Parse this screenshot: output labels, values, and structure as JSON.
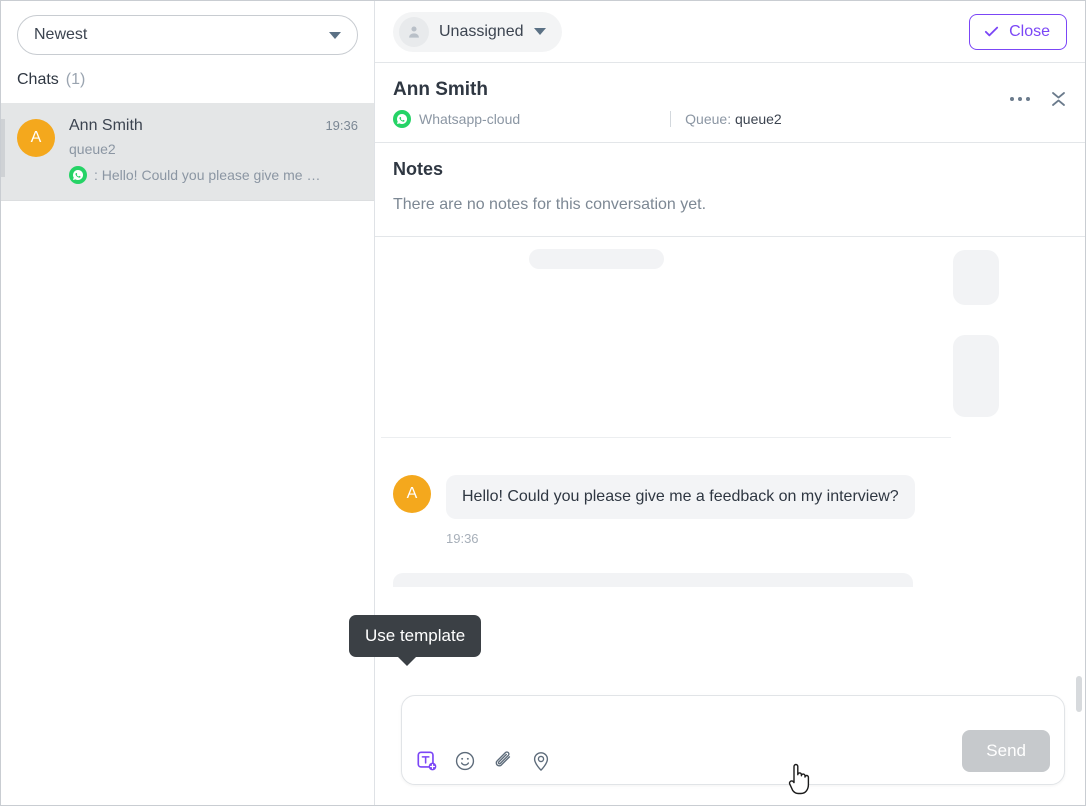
{
  "sidebar": {
    "sort": {
      "value": "Newest",
      "caret_icon": "chevron-down-icon"
    },
    "chats_header": {
      "label": "Chats",
      "count": "(1)"
    },
    "chats": [
      {
        "avatar_initial": "A",
        "name": "Ann Smith",
        "time": "19:36",
        "queue": "queue2",
        "channel_icon": "whatsapp-icon",
        "preview": ": Hello! Could you please give me …"
      }
    ]
  },
  "topbar": {
    "assignee": {
      "label": "Unassigned",
      "avatar_icon": "person-icon",
      "caret_icon": "chevron-down-icon"
    },
    "close_button": {
      "label": "Close",
      "icon": "check-icon"
    }
  },
  "contact": {
    "name": "Ann Smith",
    "channel": "Whatsapp-cloud",
    "channel_icon": "whatsapp-icon",
    "queue_label": "Queue:",
    "queue_value": "queue2",
    "more_icon": "ellipsis-icon",
    "collapse_icon": "collapse-icon"
  },
  "notes": {
    "title": "Notes",
    "empty_text": "There are no notes for this conversation yet."
  },
  "conversation": {
    "messages": [
      {
        "avatar_initial": "A",
        "text": "Hello! Could you please give me a feedback on my interview?",
        "time": "19:36"
      }
    ]
  },
  "composer": {
    "tooltip": "Use template",
    "tools": [
      {
        "name": "template-icon",
        "title": "Use template"
      },
      {
        "name": "emoji-icon",
        "title": "Emoji"
      },
      {
        "name": "attachment-icon",
        "title": "Attach file"
      },
      {
        "name": "location-icon",
        "title": "Location"
      }
    ],
    "placeholder": "",
    "value": "",
    "send_label": "Send"
  },
  "colors": {
    "accent_purple": "#7b46f6",
    "avatar_orange": "#f4a81d",
    "whatsapp_green": "#25d366",
    "tooltip_dark": "#3b4045",
    "send_disabled": "#c6c9cc"
  }
}
